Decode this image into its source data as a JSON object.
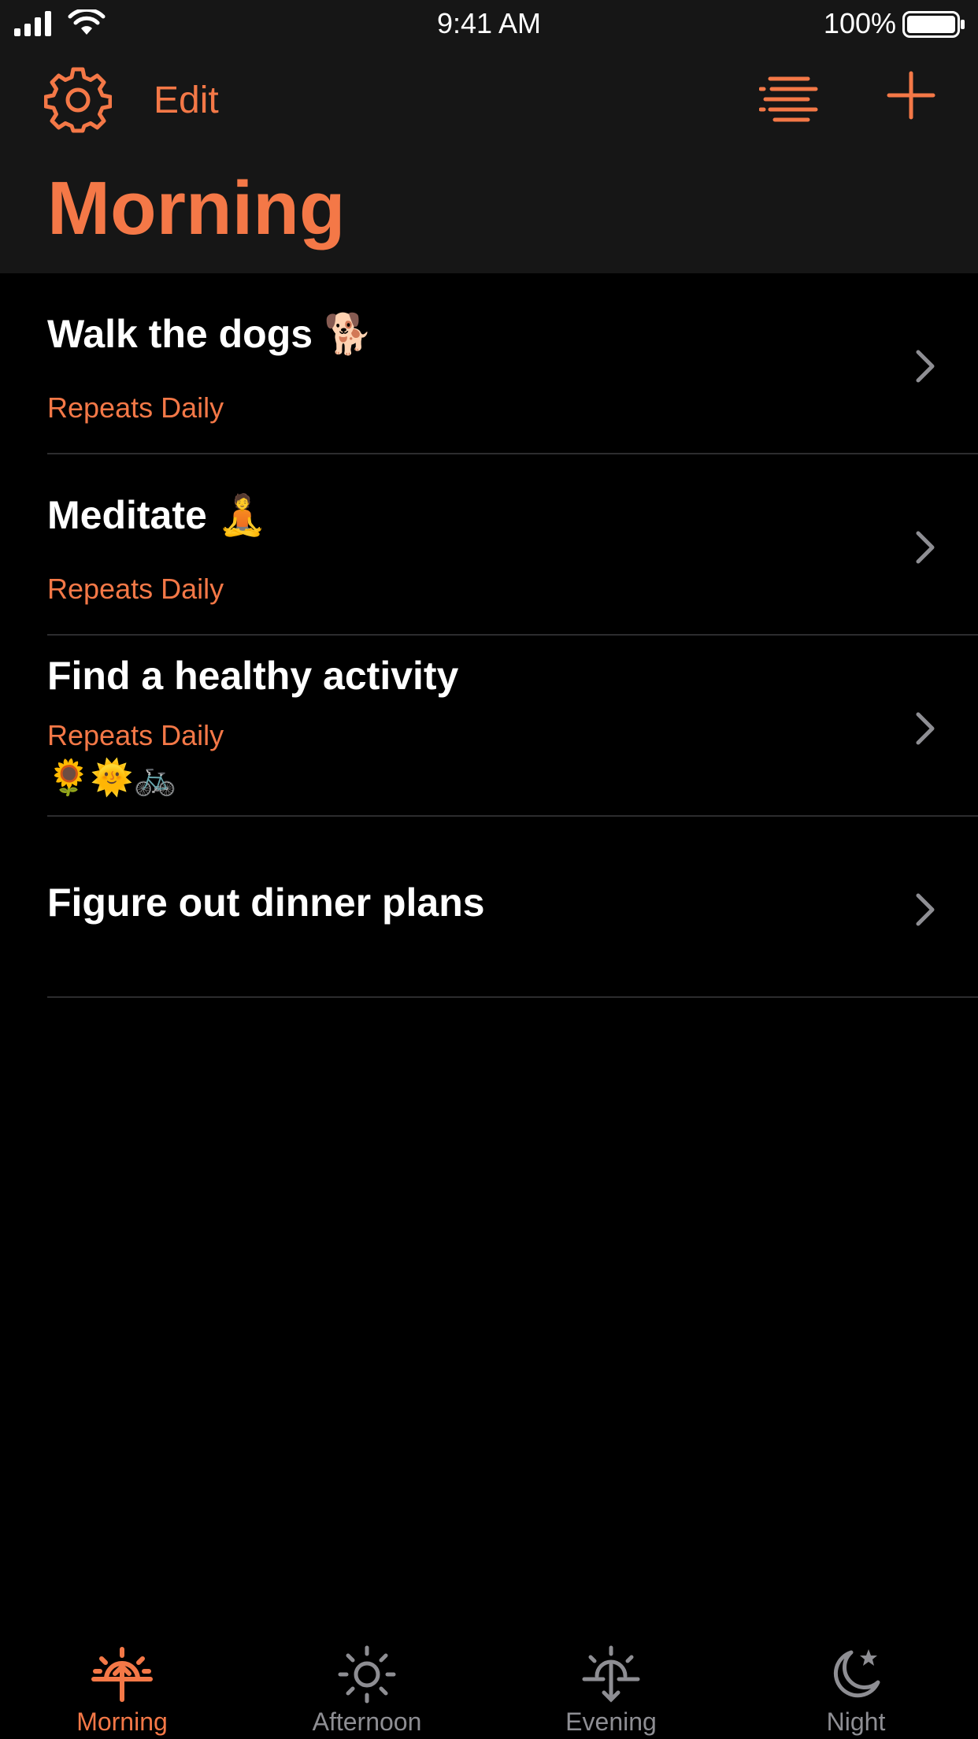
{
  "status_bar": {
    "time": "9:41 AM",
    "battery_percent": "100%",
    "battery_level": 1.0
  },
  "nav": {
    "settings_icon": "gear-icon",
    "edit_label": "Edit",
    "sort_icon": "sort-lines-icon",
    "add_icon": "plus-icon"
  },
  "page_title": "Morning",
  "tasks": [
    {
      "title": "Walk the dogs 🐕",
      "repeat": "Repeats Daily",
      "extra": ""
    },
    {
      "title": "Meditate 🧘",
      "repeat": "Repeats Daily",
      "extra": ""
    },
    {
      "title": "Find a healthy activity",
      "repeat": "Repeats Daily",
      "extra": "🌻🌞🚲"
    },
    {
      "title": "Figure out dinner plans",
      "repeat": "",
      "extra": ""
    }
  ],
  "tabs": [
    {
      "label": "Morning",
      "icon": "sunrise-icon",
      "active": true
    },
    {
      "label": "Afternoon",
      "icon": "sun-icon",
      "active": false
    },
    {
      "label": "Evening",
      "icon": "sunset-icon",
      "active": false
    },
    {
      "label": "Night",
      "icon": "moon-star-icon",
      "active": false
    }
  ],
  "colors": {
    "accent": "#f47847",
    "header_background": "#161616",
    "background": "#000000",
    "separator": "#2c2c2e",
    "inactive_tab": "#8e8e93"
  }
}
